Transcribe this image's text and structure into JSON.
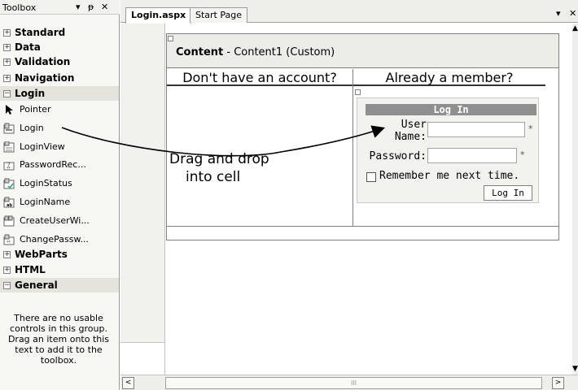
{
  "toolbox": {
    "title": "Toolbox",
    "header_buttons": [
      "▾",
      "ᵽ",
      "✕"
    ],
    "categories_top": [
      {
        "expander": "+",
        "label": "Standard"
      },
      {
        "expander": "+",
        "label": "Data"
      },
      {
        "expander": "+",
        "label": "Validation"
      },
      {
        "expander": "+",
        "label": "Navigation"
      }
    ],
    "login_category": {
      "expander": "−",
      "label": "Login"
    },
    "login_items": [
      {
        "label": "Pointer",
        "icon": "pointer-icon"
      },
      {
        "label": "Login",
        "icon": "login-control-icon"
      },
      {
        "label": "LoginView",
        "icon": "loginview-icon"
      },
      {
        "label": "PasswordRec...",
        "icon": "passwordrecovery-icon"
      },
      {
        "label": "LoginStatus",
        "icon": "loginstatus-icon"
      },
      {
        "label": "LoginName",
        "icon": "loginname-icon"
      },
      {
        "label": "CreateUserWi...",
        "icon": "createuserwizard-icon"
      },
      {
        "label": "ChangePassw...",
        "icon": "changepassword-icon"
      }
    ],
    "categories_bottom": [
      {
        "expander": "+",
        "label": "WebParts"
      },
      {
        "expander": "+",
        "label": "HTML"
      },
      {
        "expander": "−",
        "label": "General"
      }
    ],
    "general_empty_text": "There are no usable controls in this group. Drag an item onto this text to add it to the toolbox."
  },
  "tabs": {
    "active": "Login.aspx",
    "other": "Start Page",
    "menu_glyph": "▾",
    "close_glyph": "✕"
  },
  "content": {
    "name": "Content",
    "subtitle": " - Content1 (Custom)"
  },
  "table": {
    "left_header": "Don't have an account?",
    "right_header": "Already a member?",
    "drag_line1": "Drag and drop",
    "drag_line2": "into cell"
  },
  "login_control": {
    "title": "Log In",
    "user_label_1": "User",
    "user_label_2": "Name:",
    "password_label": "Password:",
    "required_star": "*",
    "remember_label": "Remember me next time.",
    "button_label": "Log In"
  },
  "scrollbars": {
    "left_arrow": "<",
    "right_arrow": ">",
    "thumb_grip": "III"
  }
}
